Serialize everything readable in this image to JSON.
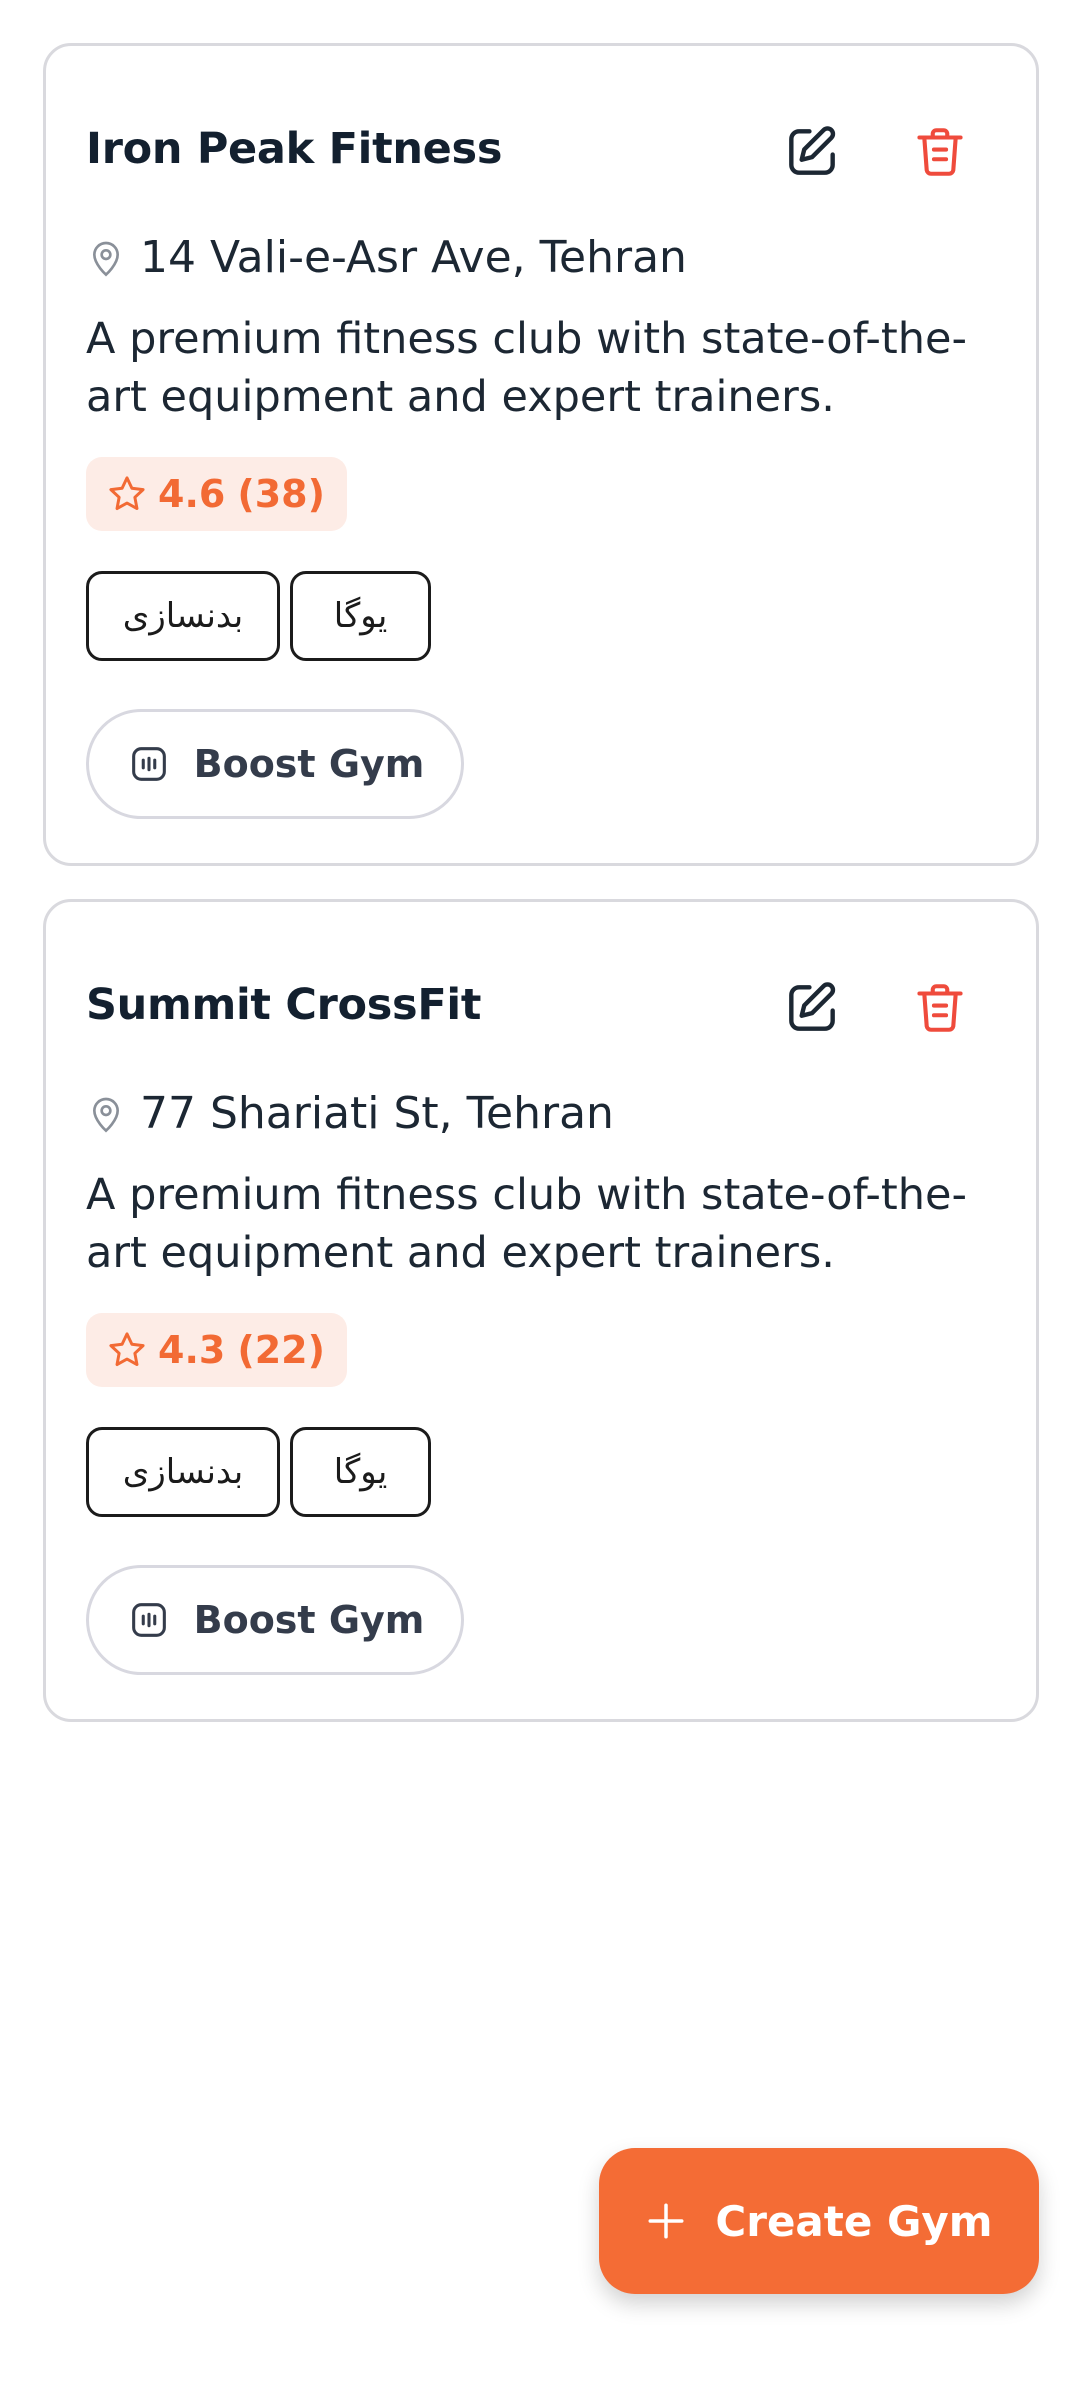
{
  "gyms": [
    {
      "name": "Iron Peak Fitness",
      "address": "14 Vali-e-Asr Ave, Tehran",
      "description": "A premium fitness club with state-of-the-art equipment and expert trainers.",
      "rating": "4.6",
      "review_count": "(38)",
      "tags": [
        "بدنسازی",
        "یوگا"
      ],
      "boost_label": "Boost Gym"
    },
    {
      "name": "Summit CrossFit",
      "address": "77 Shariati St, Tehran",
      "description": "A premium fitness club with state-of-the-art equipment and expert trainers.",
      "rating": "4.3",
      "review_count": "(22)",
      "tags": [
        "بدنسازی",
        "یوگا"
      ],
      "boost_label": "Boost Gym"
    }
  ],
  "fab": {
    "label": "Create Gym"
  },
  "colors": {
    "accent": "#f46c35",
    "danger": "#ef4b3c",
    "rating_bg": "#fdece6",
    "border": "#d9d9de",
    "title": "#13202f"
  },
  "icons": {
    "edit": "edit-icon",
    "delete": "trash-icon",
    "location": "map-pin-icon",
    "rating": "star-icon",
    "boost": "boost-icon",
    "create": "plus-icon"
  }
}
